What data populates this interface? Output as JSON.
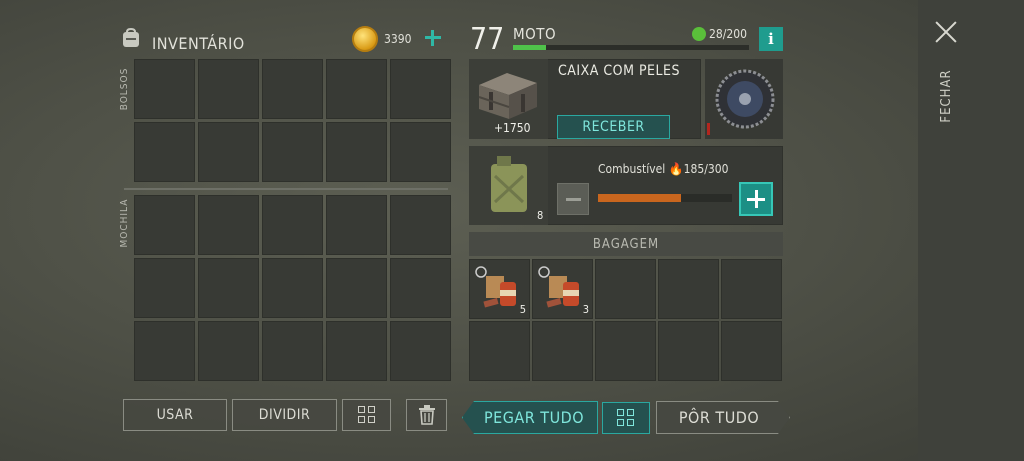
{
  "close": {
    "label": "FECHAR",
    "icon": "close-icon"
  },
  "inventory": {
    "title": "INVENTÁRIO",
    "coins": "3390",
    "pockets_label": "BOLSOS",
    "backpack_label": "MOCHILA"
  },
  "actions": {
    "use": "USAR",
    "split": "DIVIDIR"
  },
  "vehicle": {
    "level": "77",
    "name": "MOTO",
    "progress": 0.14,
    "capacity": "28/200"
  },
  "reward": {
    "title": "CAIXA COM PELES",
    "value": "+1750",
    "receive_label": "RECEBER"
  },
  "fuel": {
    "label": "Combustível",
    "value": "185/300",
    "fraction": 0.617,
    "cans": "8"
  },
  "luggage": {
    "title": "BAGAGEM",
    "items": [
      {
        "name": "ration-pack",
        "count": "5"
      },
      {
        "name": "ration-pack",
        "count": "3"
      }
    ]
  },
  "transfer": {
    "take_all": "PEGAR TUDO",
    "put_all": "PÔR TUDO"
  },
  "colors": {
    "accent": "#2aa8a0",
    "progress": "#4fc24a",
    "fuel": "#c9661e"
  }
}
